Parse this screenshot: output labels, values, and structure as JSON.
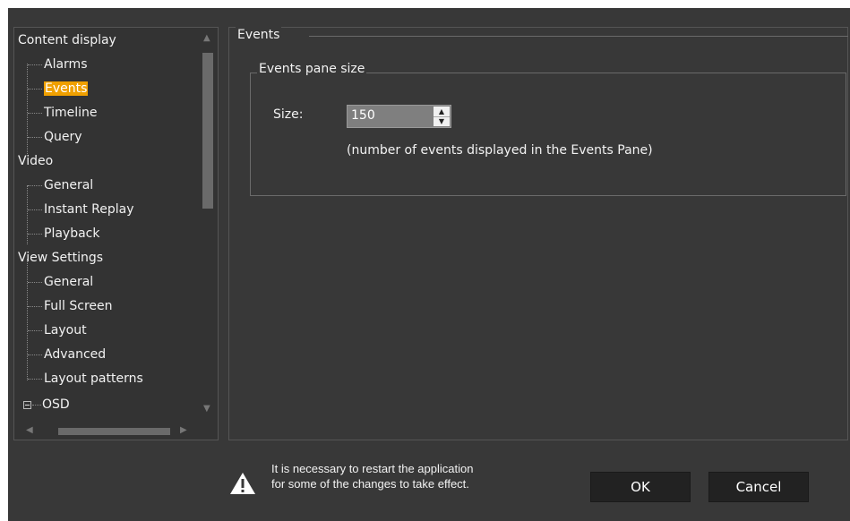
{
  "tree": {
    "items": [
      {
        "label": "Content display",
        "level": 0
      },
      {
        "label": "Alarms",
        "level": 1
      },
      {
        "label": "Events",
        "level": 1,
        "selected": true
      },
      {
        "label": "Timeline",
        "level": 1
      },
      {
        "label": "Query",
        "level": 1
      },
      {
        "label": "Video",
        "level": 0
      },
      {
        "label": "General",
        "level": 1
      },
      {
        "label": "Instant Replay",
        "level": 1
      },
      {
        "label": "Playback",
        "level": 1
      },
      {
        "label": "View Settings",
        "level": 0
      },
      {
        "label": "General",
        "level": 1
      },
      {
        "label": "Full Screen",
        "level": 1
      },
      {
        "label": "Layout",
        "level": 1
      },
      {
        "label": "Advanced",
        "level": 1
      },
      {
        "label": "Layout patterns",
        "level": 1
      },
      {
        "label": "OSD",
        "level": 0,
        "expander": true
      }
    ]
  },
  "panel": {
    "group_title": "Events",
    "subgroup_title": "Events pane size",
    "size_label": "Size:",
    "size_value": "150",
    "note": "(number of events displayed in the Events Pane)"
  },
  "footer": {
    "warning_line1": "It is necessary to restart the application",
    "warning_line2": "for some of the changes to take effect.",
    "ok_label": "OK",
    "cancel_label": "Cancel"
  },
  "colors": {
    "background": "#383838",
    "selection": "#f0a000",
    "button": "#222222"
  }
}
